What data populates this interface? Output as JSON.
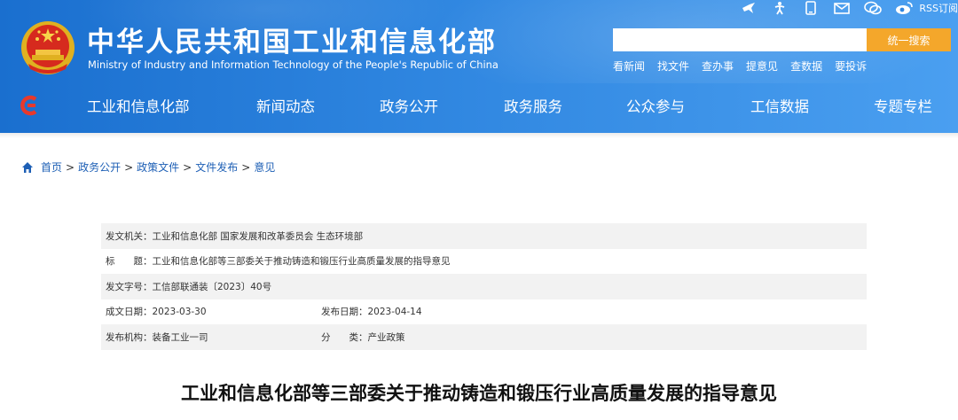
{
  "header": {
    "title_cn": "中华人民共和国工业和信息化部",
    "title_en": "Ministry of Industry and Information Technology of the People's Republic of China",
    "top_icons": [
      "bird-icon",
      "accessibility-icon",
      "mobile-icon",
      "mail-icon",
      "wechat-icon",
      "weibo-icon"
    ],
    "rss_label": "RSS订阅",
    "search": {
      "placeholder": "",
      "button_label": "统一搜索"
    },
    "quick_links": [
      "看新闻",
      "找文件",
      "查办事",
      "提意见",
      "查数据",
      "要投诉"
    ]
  },
  "nav": {
    "items": [
      "工业和信息化部",
      "新闻动态",
      "政务公开",
      "政务服务",
      "公众参与",
      "工信数据",
      "专题专栏"
    ]
  },
  "breadcrumb": {
    "items": [
      "首页",
      "政务公开",
      "政策文件",
      "文件发布",
      "意见"
    ],
    "separator": ">"
  },
  "info": {
    "issuer_label": "发文机关：",
    "issuer_value": "工业和信息化部 国家发展和改革委员会 生态环境部",
    "title_label": "标　　题：",
    "title_value": "工业和信息化部等三部委关于推动铸造和锻压行业高质量发展的指导意见",
    "docno_label": "发文字号：",
    "docno_value": "工信部联通装〔2023〕40号",
    "written_label": "成文日期：",
    "written_value": "2023-03-30",
    "published_label": "发布日期：",
    "published_value": "2023-04-14",
    "org_label": "发布机构：",
    "org_value": "装备工业一司",
    "category_label": "分　　类：",
    "category_value": "产业政策"
  },
  "article": {
    "title": "工业和信息化部等三部委关于推动铸造和锻压行业高质量发展的指导意见"
  },
  "colors": {
    "header_blue": "#2f86e0",
    "search_button": "#f4a72b",
    "breadcrumb_link": "#1d5fb5",
    "row_shade": "#f2f2f2"
  }
}
